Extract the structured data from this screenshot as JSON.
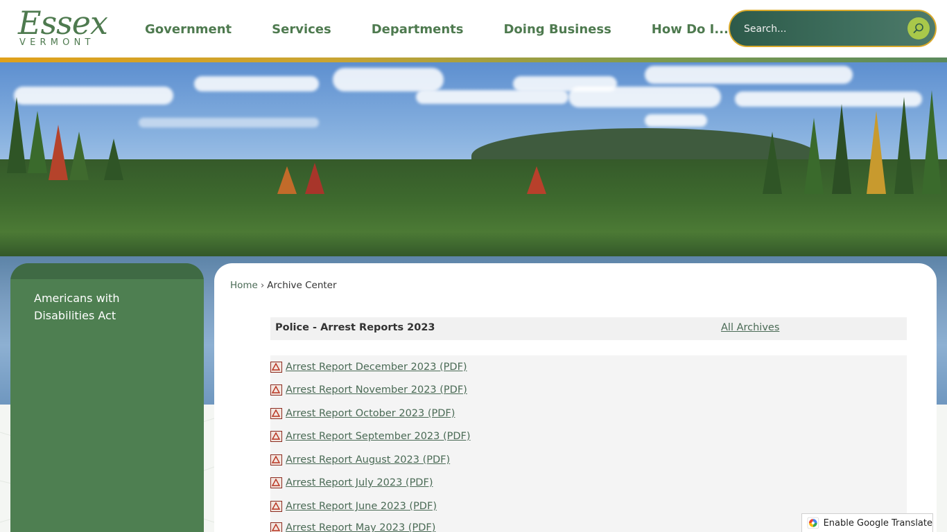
{
  "logo": {
    "main": "Essex",
    "sub": "VERMONT"
  },
  "nav": {
    "items": [
      {
        "label": "Government"
      },
      {
        "label": "Services"
      },
      {
        "label": "Departments"
      },
      {
        "label": "Doing Business"
      },
      {
        "label": "How Do I..."
      }
    ]
  },
  "search": {
    "placeholder": "Search..."
  },
  "sidebar": {
    "items": [
      {
        "label": "Americans with Disabilities Act"
      }
    ]
  },
  "breadcrumb": {
    "home": "Home",
    "separator": "›",
    "current": "Archive Center"
  },
  "archive": {
    "title": "Police - Arrest Reports 2023",
    "all_archives_label": "All Archives",
    "items": [
      {
        "label": "Arrest Report December 2023 (PDF)"
      },
      {
        "label": "Arrest Report November 2023 (PDF)"
      },
      {
        "label": "Arrest Report October 2023 (PDF)"
      },
      {
        "label": "Arrest Report September 2023 (PDF)"
      },
      {
        "label": "Arrest Report August 2023 (PDF)"
      },
      {
        "label": "Arrest Report July 2023 (PDF)"
      },
      {
        "label": "Arrest Report June 2023 (PDF)"
      },
      {
        "label": "Arrest Report May 2023 (PDF)"
      }
    ]
  },
  "translate": {
    "label": "Enable Google Translate"
  },
  "colors": {
    "brand_green": "#4e7a4f",
    "sidebar_green": "#4e7f51",
    "search_bg": "#2d5a4a",
    "search_border": "#d9a92a",
    "search_button": "#a9c84a",
    "link": "#4a6a55"
  },
  "icons": {
    "search": "search-icon",
    "pdf": "pdf-icon",
    "google_translate": "google-translate-icon"
  }
}
